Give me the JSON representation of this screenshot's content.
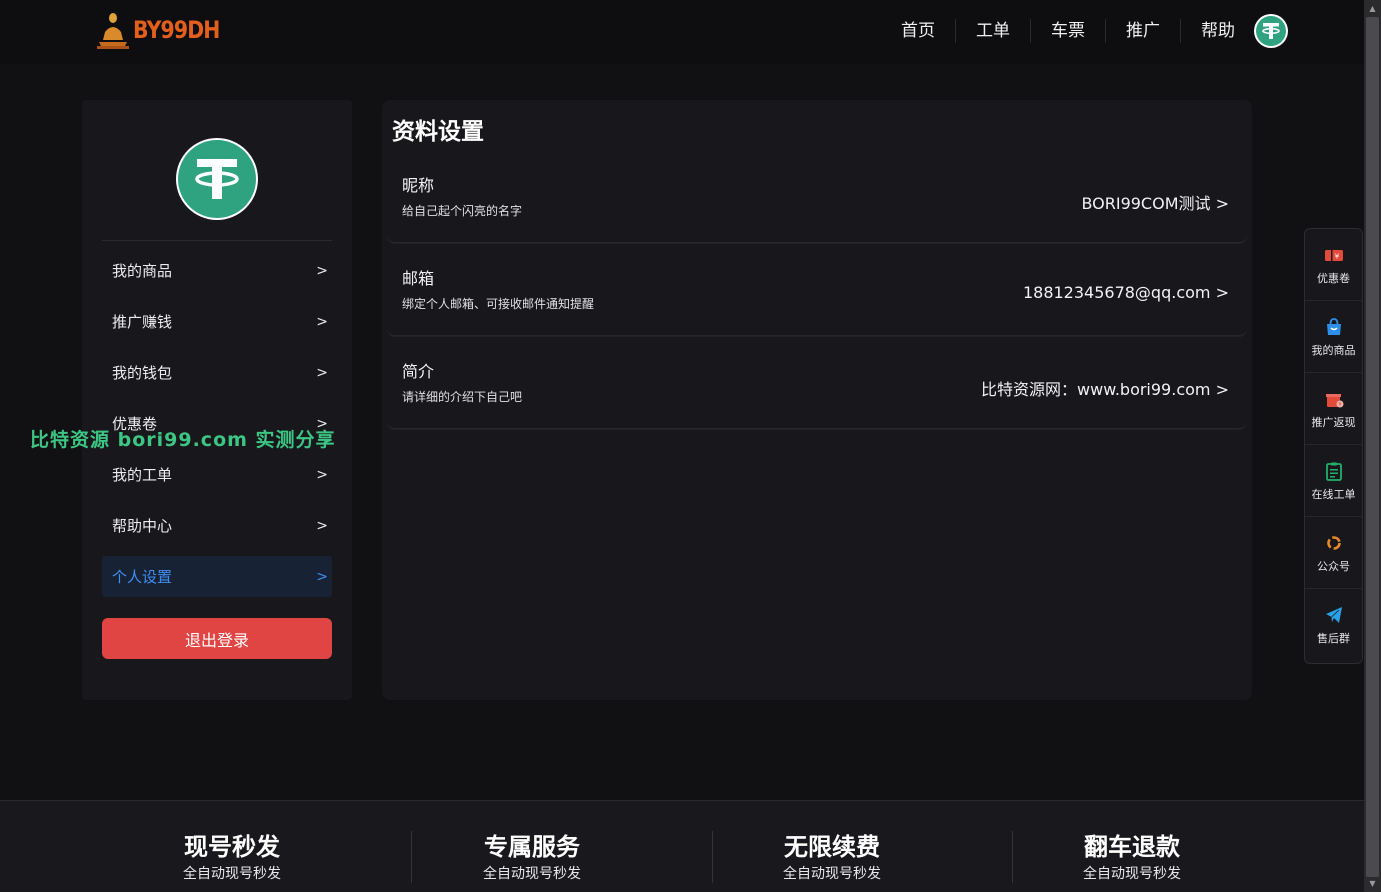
{
  "header": {
    "logo_text": "BY99DH",
    "nav": [
      "首页",
      "工单",
      "车票",
      "推广",
      "帮助"
    ]
  },
  "colors": {
    "accent_blue": "#3d8ff0",
    "logout_red": "#e04443",
    "tether_green": "#2fa37f",
    "logo_orange": "#e2601c",
    "watermark_green": "#3fcf8a"
  },
  "sidebar": {
    "menu": [
      {
        "label": "我的商品",
        "arrow": ">"
      },
      {
        "label": "推广赚钱",
        "arrow": ">"
      },
      {
        "label": "我的钱包",
        "arrow": ">"
      },
      {
        "label": "优惠卷",
        "arrow": ">"
      },
      {
        "label": "我的工单",
        "arrow": ">"
      },
      {
        "label": "帮助中心",
        "arrow": ">"
      },
      {
        "label": "个人设置",
        "arrow": ">",
        "active": true
      }
    ],
    "logout_label": "退出登录"
  },
  "watermark": "比特资源 bori99.com 实测分享",
  "main": {
    "title": "资料设置",
    "rows": [
      {
        "label": "昵称",
        "desc": "给自己起个闪亮的名字",
        "value": "BORI99COM测试 >"
      },
      {
        "label": "邮箱",
        "desc": "绑定个人邮箱、可接收邮件通知提醒",
        "value": "18812345678@qq.com >"
      },
      {
        "label": "简介",
        "desc": "请详细的介绍下自己吧",
        "value": "比特资源网：www.bori99.com >"
      }
    ]
  },
  "float_panel": [
    {
      "label": "优惠卷",
      "icon": "coupon-icon"
    },
    {
      "label": "我的商品",
      "icon": "shopping-bag-icon"
    },
    {
      "label": "推广返现",
      "icon": "gift-icon"
    },
    {
      "label": "在线工单",
      "icon": "clipboard-icon"
    },
    {
      "label": "公众号",
      "icon": "wechat-official-icon"
    },
    {
      "label": "售后群",
      "icon": "telegram-icon"
    }
  ],
  "footer": {
    "features": [
      {
        "title": "现号秒发",
        "sub": "全自动现号秒发"
      },
      {
        "title": "专属服务",
        "sub": "全自动现号秒发"
      },
      {
        "title": "无限续费",
        "sub": "全自动现号秒发"
      },
      {
        "title": "翻车退款",
        "sub": "全自动现号秒发"
      }
    ]
  }
}
